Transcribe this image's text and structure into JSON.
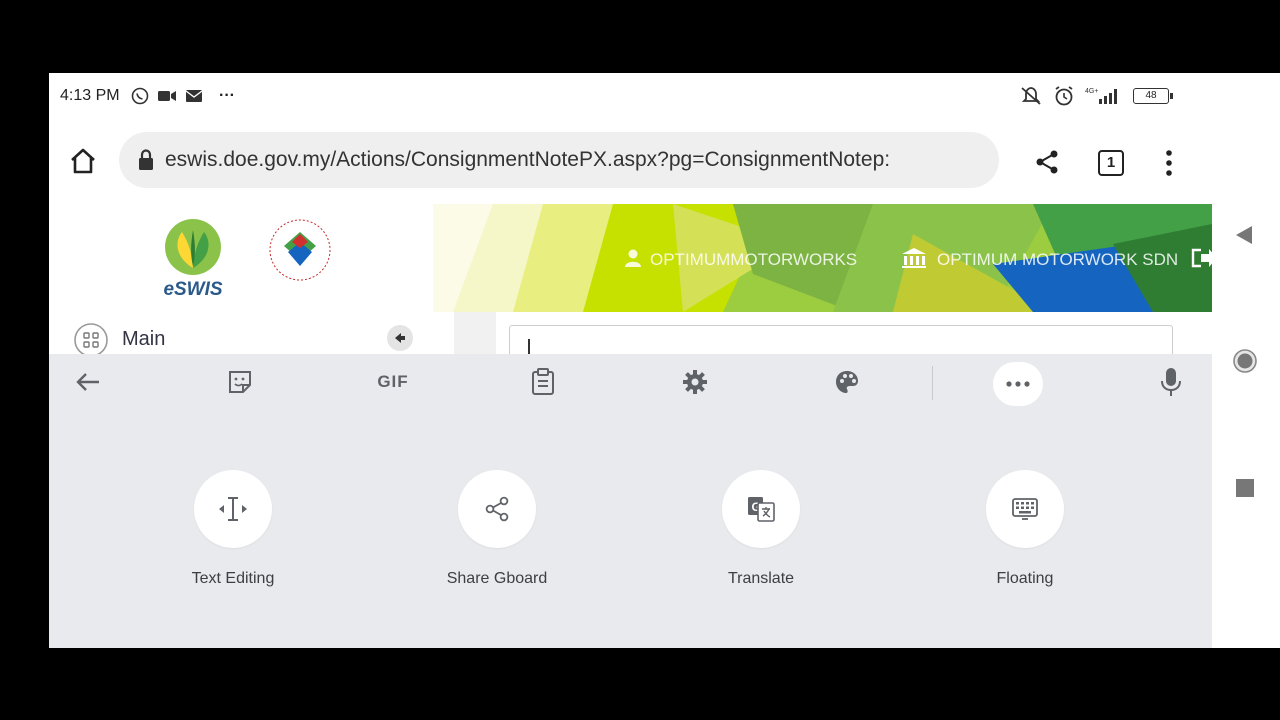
{
  "status_bar": {
    "time": "4:13 PM",
    "more": "···",
    "battery": "48",
    "network": "4G+"
  },
  "browser": {
    "url": "eswis.doe.gov.my/Actions/ConsignmentNotePX.aspx?pg=ConsignmentNotep:",
    "tab_count": "1"
  },
  "site": {
    "logo_text": "eSWIS",
    "username": "OPTIMUMMOTORWORKS",
    "company": "OPTIMUM MOTORWORK SDN",
    "menu_label": "Main",
    "banner_colors": [
      "#d4e157",
      "#8bc34a",
      "#43a047",
      "#1565c0",
      "#c6e000"
    ]
  },
  "keyboard": {
    "toolbar": {
      "gif_label": "GIF"
    },
    "options": [
      {
        "label": "Text Editing",
        "icon": "text-cursor-icon"
      },
      {
        "label": "Share Gboard",
        "icon": "share-icon"
      },
      {
        "label": "Translate",
        "icon": "translate-icon"
      },
      {
        "label": "Floating",
        "icon": "floating-keyboard-icon"
      }
    ]
  }
}
